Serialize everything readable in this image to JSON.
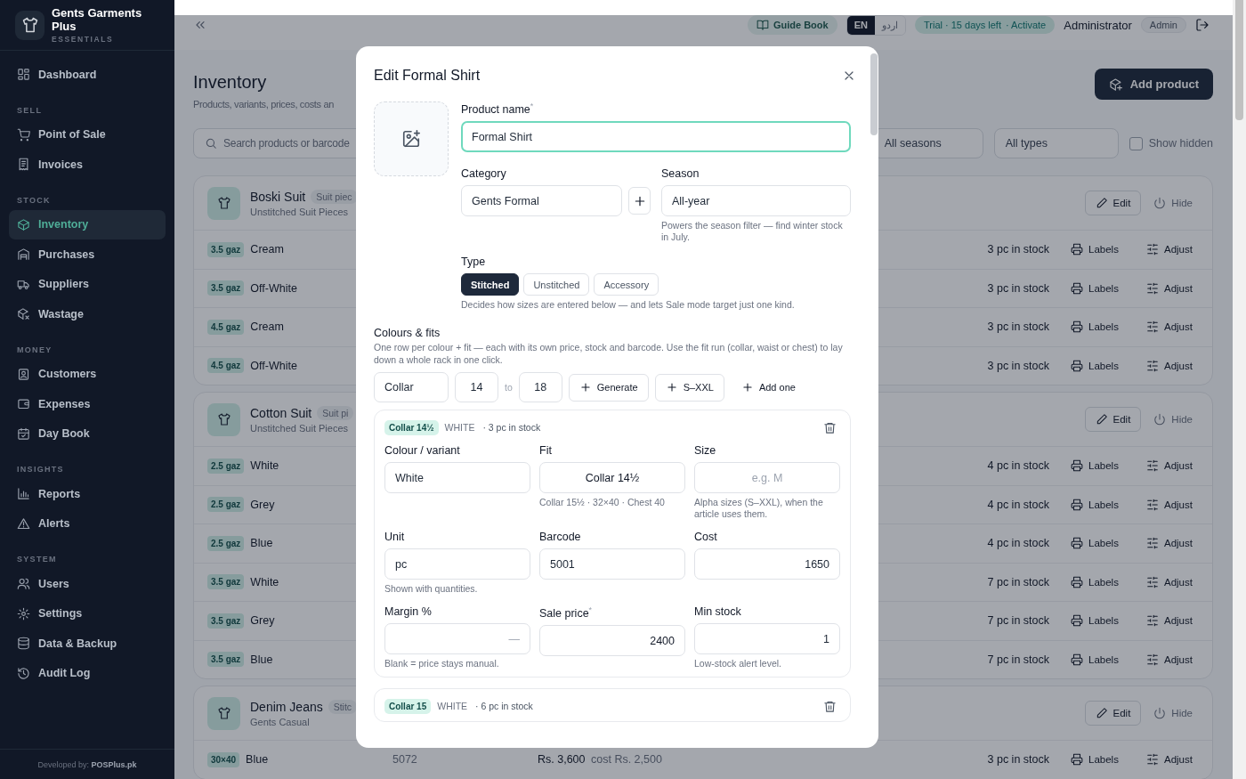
{
  "sidebar": {
    "brand": {
      "name": "Gents Garments Plus",
      "tagline": "ESSENTIALS"
    },
    "nav": [
      {
        "items": [
          {
            "label": "Dashboard",
            "selected": false
          }
        ]
      },
      {
        "heading": "SELL",
        "items": [
          {
            "label": "Point of Sale",
            "selected": false
          },
          {
            "label": "Invoices",
            "selected": false
          }
        ]
      },
      {
        "heading": "STOCK",
        "items": [
          {
            "label": "Inventory",
            "selected": true
          },
          {
            "label": "Purchases",
            "selected": false
          },
          {
            "label": "Suppliers",
            "selected": false
          },
          {
            "label": "Wastage",
            "selected": false
          }
        ]
      },
      {
        "heading": "MONEY",
        "items": [
          {
            "label": "Customers",
            "selected": false
          },
          {
            "label": "Expenses",
            "selected": false
          },
          {
            "label": "Day Book",
            "selected": false
          }
        ]
      },
      {
        "heading": "INSIGHTS",
        "items": [
          {
            "label": "Reports",
            "selected": false
          },
          {
            "label": "Alerts",
            "selected": false
          }
        ]
      },
      {
        "heading": "SYSTEM",
        "items": [
          {
            "label": "Users",
            "selected": false
          },
          {
            "label": "Settings",
            "selected": false
          },
          {
            "label": "Data & Backup",
            "selected": false
          },
          {
            "label": "Audit Log",
            "selected": false
          }
        ]
      }
    ],
    "footer": "Developed by: **POSPlus.pk**"
  },
  "topbar": {
    "guide": "Guide Book",
    "languages": [
      {
        "label": "EN",
        "selected": true
      },
      {
        "label": "اردو",
        "selected": false
      }
    ],
    "trial": "Trial · 15 days left",
    "activate": "· Activate",
    "user": "Administrator",
    "role": "Admin"
  },
  "page": {
    "title": "Inventory",
    "subtitle": "Products, variants, prices, costs an",
    "add_button": "Add product",
    "filters": {
      "search_placeholder": "Search products or barcode",
      "season": "All seasons",
      "type": "All types",
      "show_hidden": {
        "label": "Show hidden",
        "checked": false
      }
    }
  },
  "products": [
    {
      "name": "Boski Suit",
      "badge": "Suit piec",
      "subtitle": "Unstitched Suit Pieces",
      "edit": "Edit",
      "hide": "Hide",
      "variants": [
        {
          "size": "3.5 gaz",
          "colour": "Cream",
          "stock": "3 pc in stock",
          "labels": "Labels",
          "adjust": "Adjust"
        },
        {
          "size": "3.5 gaz",
          "colour": "Off-White",
          "stock": "3 pc in stock",
          "labels": "Labels",
          "adjust": "Adjust"
        },
        {
          "size": "4.5 gaz",
          "colour": "Cream",
          "stock": "3 pc in stock",
          "labels": "Labels",
          "adjust": "Adjust"
        },
        {
          "size": "4.5 gaz",
          "colour": "Off-White",
          "stock": "3 pc in stock",
          "labels": "Labels",
          "adjust": "Adjust"
        }
      ]
    },
    {
      "name": "Cotton Suit",
      "badge": "Suit pi",
      "subtitle": "Unstitched Suit Pieces",
      "edit": "Edit",
      "hide": "Hide",
      "variants": [
        {
          "size": "2.5 gaz",
          "colour": "White",
          "stock": "4 pc in stock",
          "labels": "Labels",
          "adjust": "Adjust"
        },
        {
          "size": "2.5 gaz",
          "colour": "Grey",
          "stock": "4 pc in stock",
          "labels": "Labels",
          "adjust": "Adjust"
        },
        {
          "size": "2.5 gaz",
          "colour": "Blue",
          "stock": "4 pc in stock",
          "labels": "Labels",
          "adjust": "Adjust"
        },
        {
          "size": "3.5 gaz",
          "colour": "White",
          "stock": "7 pc in stock",
          "labels": "Labels",
          "adjust": "Adjust"
        },
        {
          "size": "3.5 gaz",
          "colour": "Grey",
          "stock": "7 pc in stock",
          "labels": "Labels",
          "adjust": "Adjust"
        },
        {
          "size": "3.5 gaz",
          "colour": "Blue",
          "stock": "7 pc in stock",
          "labels": "Labels",
          "adjust": "Adjust"
        }
      ]
    },
    {
      "name": "Denim Jeans",
      "badge": "Stitc",
      "subtitle": "Gents Casual",
      "edit": "Edit",
      "hide": "Hide",
      "variants": [
        {
          "size": "30×40",
          "colour": "Blue",
          "barcode": "5072",
          "price": "Rs. 3,600",
          "cost": "cost Rs. 2,500",
          "stock": "3 pc in stock",
          "labels": "Labels",
          "adjust": "Adjust"
        }
      ]
    }
  ],
  "modal": {
    "title": "Edit Formal Shirt",
    "product_name": {
      "label": "Product name$^{*}$",
      "value": "Formal Shirt",
      "focused": true
    },
    "category": {
      "label": "Category",
      "value": "Gents Formal"
    },
    "season": {
      "label": "Season",
      "value": "All-year",
      "help": "Powers the season filter — find winter stock in July."
    },
    "type": {
      "label": "Type",
      "options": [
        {
          "label": "Stitched",
          "selected": true
        },
        {
          "label": "Unstitched",
          "selected": false
        },
        {
          "label": "Accessory",
          "selected": false
        }
      ],
      "help": "Decides how sizes are entered below — and lets Sale mode target just one kind."
    },
    "colours": {
      "heading": "Colours & fits",
      "description": "One row per colour + fit — each with its own price, stock and barcode. Use the fit run (collar, waist or chest) to lay down a whole rack in one click.",
      "fit_run": {
        "dimension": "Collar",
        "from": "14",
        "to_label": "to",
        "to": "18"
      },
      "actions": [
        {
          "label": "Generate",
          "kind": "outlined"
        },
        {
          "label": "S–XXL",
          "kind": "outlined"
        },
        {
          "label": "Add one",
          "kind": "plain"
        }
      ]
    },
    "variants": [
      {
        "fit": "Collar 14½",
        "colour": "WHITE",
        "stock": "· 3 pc in stock",
        "fields": [
          {
            "label": "Colour / variant",
            "value": "White"
          },
          {
            "label": "Fit",
            "value": "Collar 14½",
            "help": "Collar 15½ · 32×40 · Chest 40"
          },
          {
            "label": "Size",
            "placeholder": "e.g. M",
            "help": "Alpha sizes (S–XXL), when the article uses them."
          },
          {
            "label": "Unit",
            "value": "pc",
            "help": "Shown with quantities."
          },
          {
            "label": "Barcode",
            "value": "5001"
          },
          {
            "label": "Cost",
            "value": "1650"
          },
          {
            "label": "Margin %",
            "placeholder": "—",
            "help": "Blank = price stays manual."
          },
          {
            "label": "Sale price$^{*}$",
            "value": "2400"
          },
          {
            "label": "Min stock",
            "value": "1",
            "help": "Low-stock alert level."
          }
        ]
      },
      {
        "fit": "Collar 15",
        "colour": "WHITE",
        "stock": "· 6 pc in stock"
      }
    ]
  }
}
